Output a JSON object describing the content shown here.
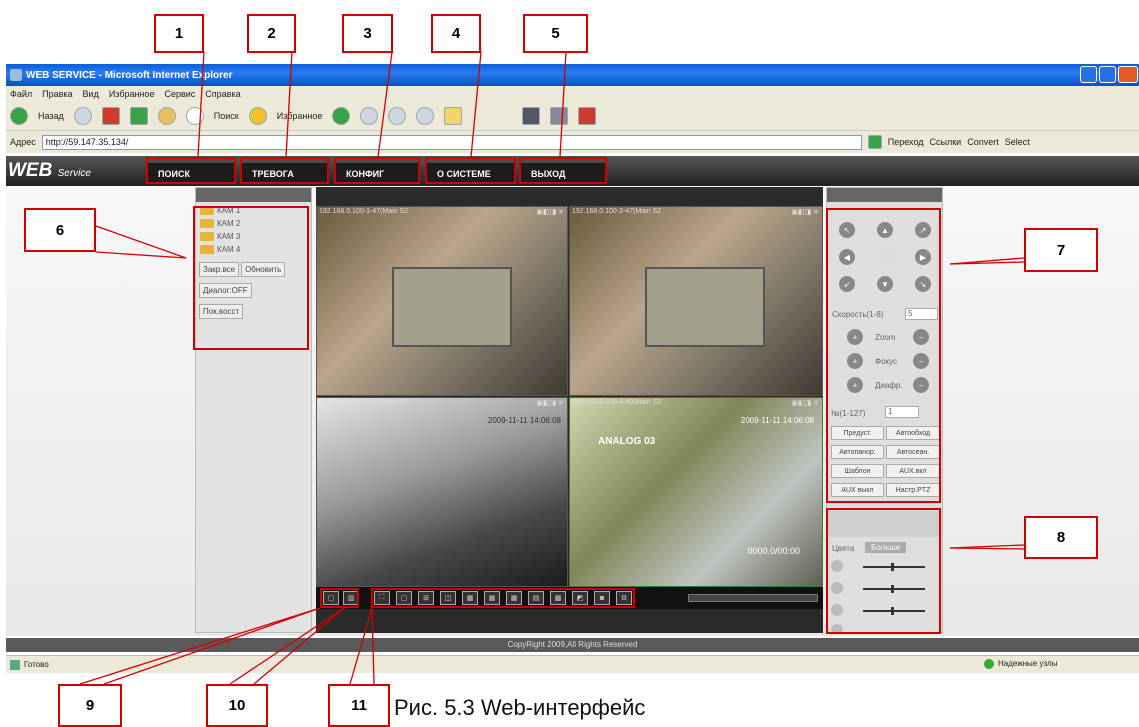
{
  "callouts": [
    "1",
    "2",
    "3",
    "4",
    "5",
    "6",
    "7",
    "8",
    "9",
    "10",
    "11"
  ],
  "window": {
    "title": "WEB SERVICE - Microsoft Internet Explorer",
    "menu": [
      "Файл",
      "Правка",
      "Вид",
      "Избранное",
      "Сервис",
      "Справка"
    ],
    "toolbar": {
      "back": "Назад",
      "search": "Поиск",
      "favorites": "Избранное"
    },
    "address_label": "Адрес",
    "address": "http://59.147.35.134/",
    "go": "Переход",
    "links": "Ссылки",
    "links_extra": [
      "Convert",
      "Select"
    ]
  },
  "app": {
    "logo": "WEB",
    "logo_sub": "Service",
    "nav": [
      "ПОИСК",
      "ТРЕВОГА",
      "КОНФИГ",
      "О СИСТЕМЕ",
      "ВЫХОД"
    ],
    "cameras": [
      "КАМ 1",
      "КАМ 2",
      "КАМ 3",
      "КАМ 4"
    ],
    "buttons": {
      "stop_all": "Закр.все",
      "refresh": "Обновить",
      "talk": "Диалог:OFF",
      "playback": "Пок.восст"
    },
    "video_labels": [
      "192.168.0.100-1-47(Main S2",
      "192.168.0.100-2-47(Main S2",
      "192.168.0.100-3-51(Main S2",
      "192.168.0.100-4-40(Main S2"
    ],
    "osd_texts": [
      "2009-11-11 14:06:08",
      "ANALOG 03",
      "2009-11-11 14:06:08",
      "0000.0/00:00"
    ],
    "ptz": {
      "speed_label": "Скорость(1-8)",
      "speed_value": "5",
      "zoom": "Zoom",
      "focus": "Фокус",
      "iris": "Диафр.",
      "no_label": "№(1-127)",
      "no_value": "1",
      "buttons": [
        "Предуст.",
        "Автообход",
        "Автопанор.",
        "Автосеан.",
        "Шаблон",
        "AUX.вкл",
        "AUX выкл",
        "Настр.PTZ"
      ]
    },
    "color_tabs": [
      "Цвета",
      "Больше"
    ],
    "footer": "CopyRight 2009,All Rights Reserved"
  },
  "status": {
    "left": "Готово",
    "right": "Надежные узлы"
  },
  "caption": "Рис. 5.3 Web-интерфейс"
}
